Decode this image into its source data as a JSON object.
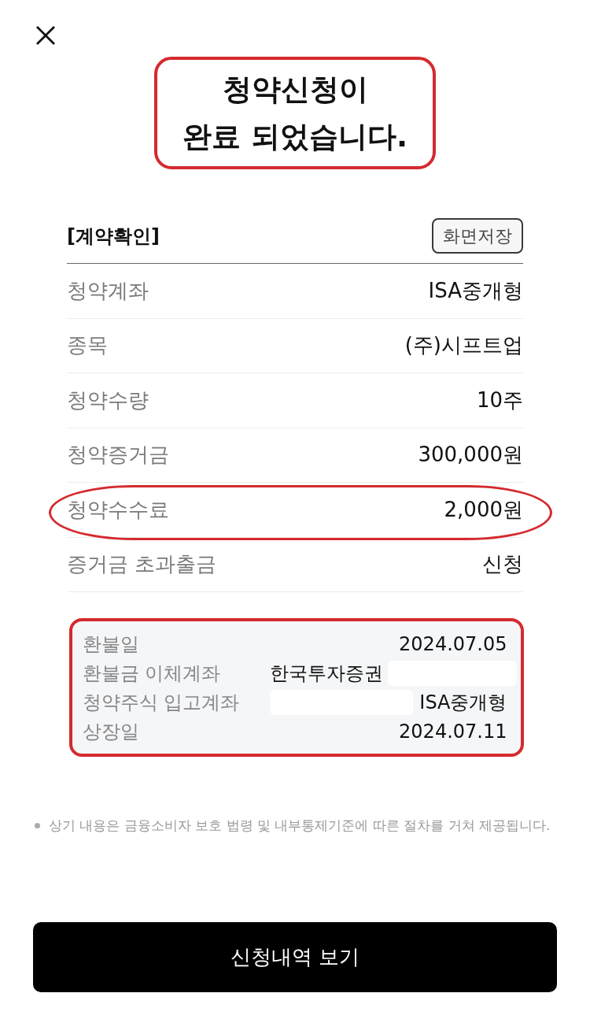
{
  "title": {
    "text": "청약신청이\n완료 되었습니다.",
    "highlighted": true
  },
  "contract": {
    "heading": "[계약확인]",
    "save_button": "화면저장",
    "rows": [
      {
        "label": "청약계좌",
        "value": "ISA중개형",
        "highlighted": false
      },
      {
        "label": "종목",
        "value": "(주)시프트업",
        "highlighted": false
      },
      {
        "label": "청약수량",
        "value": "10주",
        "highlighted": false
      },
      {
        "label": "청약증거금",
        "value": "300,000원",
        "highlighted": false
      },
      {
        "label": "청약수수료",
        "value": "2,000원",
        "highlighted": true
      },
      {
        "label": "증거금 초과출금",
        "value": "신청",
        "highlighted": false
      }
    ]
  },
  "info_box": {
    "highlighted": true,
    "rows": [
      {
        "kind": "plain",
        "label": "환불일",
        "value": "2024.07.05"
      },
      {
        "kind": "masked_after",
        "label": "환불금 이체계좌",
        "value": "한국투자증권"
      },
      {
        "kind": "masked_before",
        "label": "청약주식 입고계좌",
        "value": "ISA중개형"
      },
      {
        "kind": "plain",
        "label": "상장일",
        "value": "2024.07.11"
      }
    ]
  },
  "notice": "상기 내용은 금융소비자 보호 법령 및 내부통제기준에 따른 절차를 거쳐 제공됩니다.",
  "primary_button": "신청내역 보기"
}
